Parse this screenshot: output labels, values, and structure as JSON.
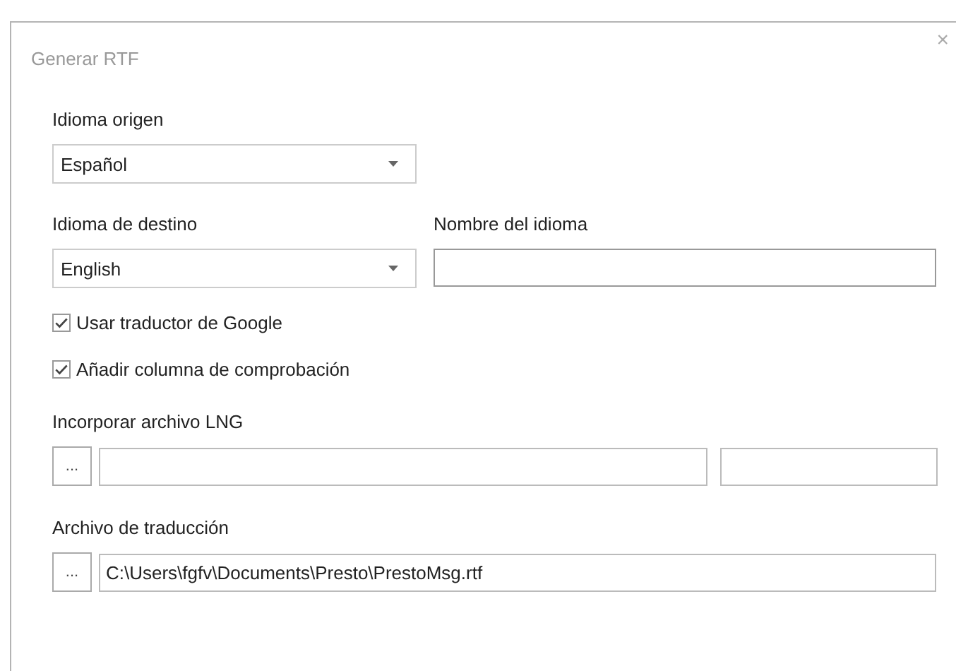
{
  "window": {
    "title": "Generar RTF",
    "close": "×"
  },
  "source_language": {
    "label": "Idioma origen",
    "value": "Español"
  },
  "target_language": {
    "label": "Idioma de destino",
    "value": "English"
  },
  "language_name": {
    "label": "Nombre del idioma"
  },
  "options": [
    {
      "label": "Usar traductor de Google",
      "checked": true
    },
    {
      "label": "Añadir columna de comprobación",
      "checked": true
    }
  ],
  "lng_file": {
    "label": "Incorporar archivo LNG",
    "browse": "..."
  },
  "translation_file": {
    "label": "Archivo de traducción",
    "browse": "...",
    "value": "C:\\Users\\fgfv\\Documents\\Presto\\PrestoMsg.rtf"
  }
}
